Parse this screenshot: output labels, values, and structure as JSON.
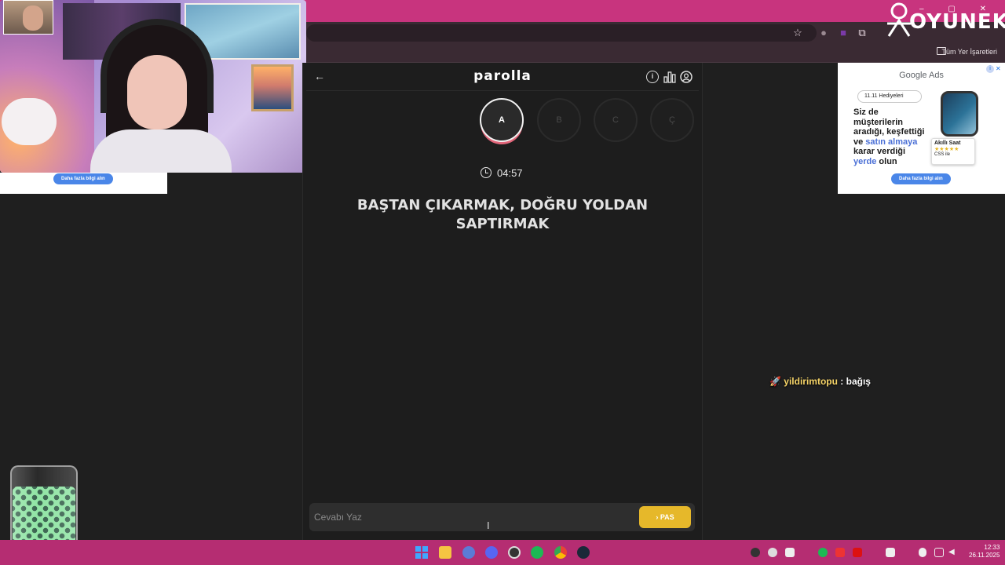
{
  "browser": {
    "bookmarks_label": "Tüm Yer İşaretleri"
  },
  "brand": {
    "name": "OYUNEKS"
  },
  "ads": {
    "left_cta": "Daha fazla bilgi alın",
    "right_title": "Google Ads",
    "right_search": "11.11 Hediyeleri",
    "right_headline_1": "Siz de",
    "right_headline_2": "müşterilerin",
    "right_headline_3": "aradığı, keşfettiği",
    "right_headline_4": "ve ",
    "right_headline_4b": "satın almaya",
    "right_headline_5": "karar verdiği",
    "right_headline_6": "yerde",
    "right_headline_6b": " olun",
    "card_title": "Akıllı Saat",
    "card_sub": "CSS ile",
    "right_cta": "Daha fazla bilgi alın",
    "info_glyph": "i",
    "close_glyph": "✕"
  },
  "game": {
    "logo": "parolla",
    "back_glyph": "←",
    "letters": [
      {
        "label": "A",
        "active": true
      },
      {
        "label": "B",
        "active": false
      },
      {
        "label": "C",
        "active": false
      },
      {
        "label": "Ç",
        "active": false
      }
    ],
    "timer": "04:57",
    "clue": "BAŞTAN ÇIKARMAK, DOĞRU YOLDAN SAPTIRMAK",
    "answer_placeholder": "Cevabı Yaz",
    "pass_label": "PAS"
  },
  "overlay": {
    "donation_user": "yildirimtopu",
    "donation_text": " : bağış"
  },
  "taskbar": {
    "time": "12:33",
    "date": "26.11.2025"
  },
  "colors": {
    "titlebar": "#c8347e",
    "taskbar": "#b52d72",
    "accent_pass": "#e6b82a",
    "active_ring": "#e2667a"
  }
}
